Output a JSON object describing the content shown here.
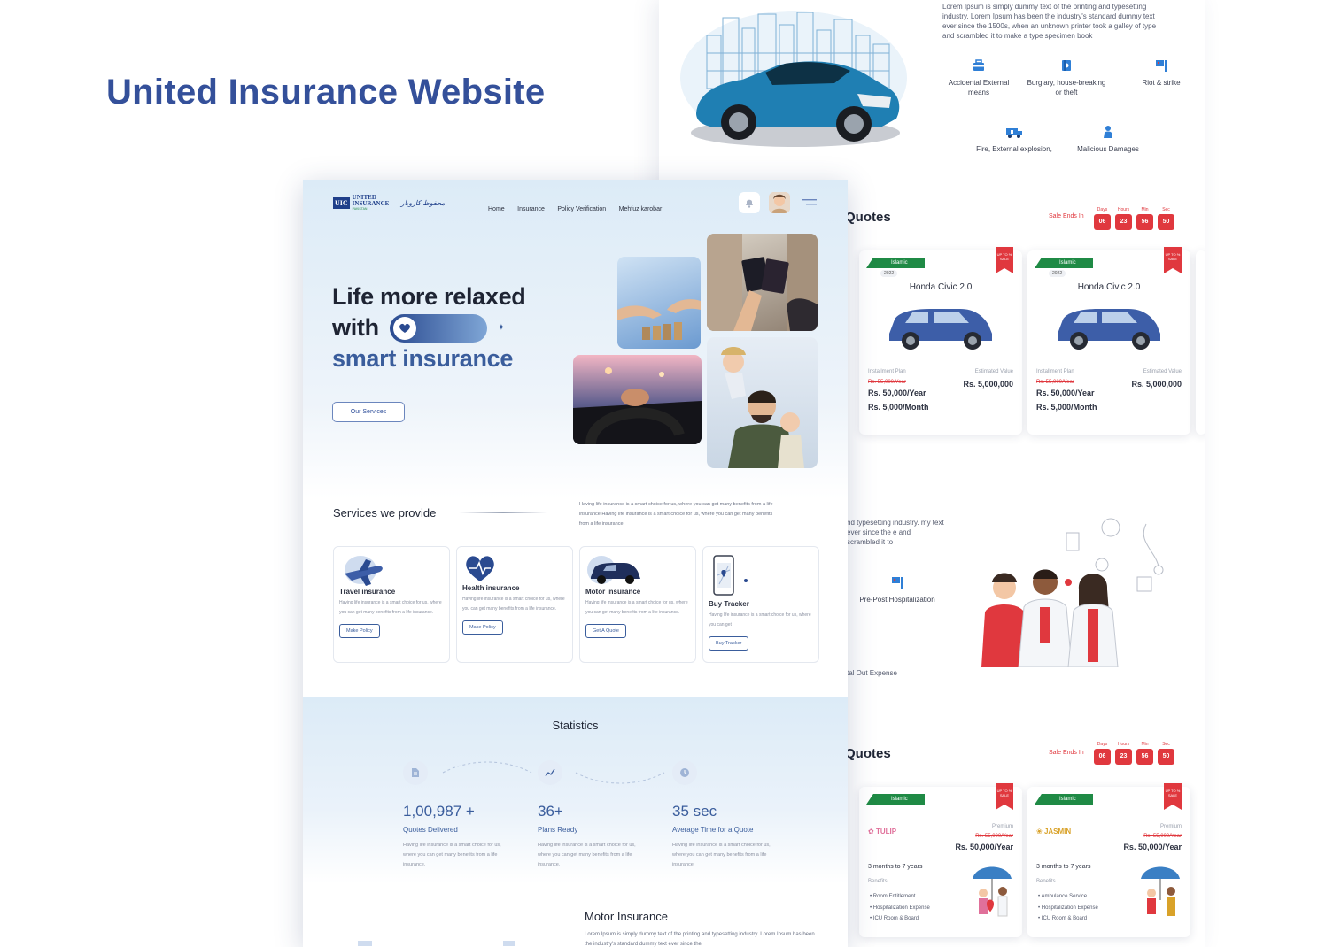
{
  "headline": "United Insurance Website",
  "back_page": {
    "intro_text": "Lorem Ipsum is simply dummy text of the printing and typesetting industry. Lorem Ipsum has been the industry's standard dummy text ever since the 1500s, when an unknown printer took a galley of type and scrambled it to make a type specimen book",
    "coverage_icons": [
      {
        "label": "Accidental External means",
        "icon": "toolbox-icon"
      },
      {
        "label": "Burglary, house-breaking or theft",
        "icon": "safe-icon"
      },
      {
        "label": "Riot & strike",
        "icon": "flag-icon"
      },
      {
        "label": "Fire, External explosion,",
        "icon": "fire-truck-icon"
      },
      {
        "label": "Malicious Damages",
        "icon": "person-icon"
      }
    ],
    "quotes_title": "Quotes",
    "sale_label": "Sale Ends In",
    "countdown": [
      {
        "unit": "Days",
        "value": "06"
      },
      {
        "unit": "Hours",
        "value": "23"
      },
      {
        "unit": "Min",
        "value": "56"
      },
      {
        "unit": "Sec",
        "value": "50"
      }
    ],
    "car_cards": [
      {
        "tag": "Islamic",
        "year": "2022",
        "ribbon": "UP TO % SALE",
        "name": "Honda Civic 2.0",
        "installment_label": "Installment Plan",
        "estimated_label": "Estimated Value",
        "old_price": "Rs. 55,000/Year",
        "price_year": "Rs. 50,000/Year",
        "price_month": "Rs. 5,000/Month",
        "estimated_value": "Rs. 5,000,000"
      },
      {
        "tag": "Islamic",
        "year": "2022",
        "ribbon": "UP TO % SALE",
        "name": "Honda Civic 2.0",
        "installment_label": "Installment Plan",
        "estimated_label": "Estimated Value",
        "old_price": "Rs. 55,000/Year",
        "price_year": "Rs. 50,000/Year",
        "price_month": "Rs. 5,000/Month",
        "estimated_value": "Rs. 5,000,000"
      }
    ],
    "health_text": "nd typesetting industry. my text ever since the e and scrambled it to",
    "prepost_label": "Pre-Post Hospitalization",
    "outpatient_label": "tal Out Expense",
    "quotes2_title": "Quotes",
    "health_cards": [
      {
        "tag": "Islamic",
        "brand": "TULIP",
        "premium_label": "Premium",
        "old_price": "Rs. 55,000/Year",
        "price": "Rs. 50,000/Year",
        "term": "3 months to 7 years",
        "benefits_label": "Benefits",
        "benefits": [
          "Room Entitlement",
          "Hospitalization Expense",
          "ICU Room & Board"
        ]
      },
      {
        "tag": "Islamic",
        "brand": "JASMIN",
        "premium_label": "Premium",
        "old_price": "Rs. 55,000/Year",
        "price": "Rs. 50,000/Year",
        "term": "3 months to 7 years",
        "benefits_label": "Benefits",
        "benefits": [
          "Ambulance Service",
          "Hospitalization Expense",
          "ICU Room & Board"
        ]
      }
    ]
  },
  "front_page": {
    "logo": {
      "mark": "UIC",
      "name": "UNITED INSURANCE",
      "sub": "PAKISTAN"
    },
    "nav": [
      "Home",
      "Insurance",
      "Policy Verification",
      "Mehfuz karobar"
    ],
    "hero": {
      "line1": "Life more relaxed",
      "line2": "with",
      "line3": "smart insurance",
      "button": "Our Services"
    },
    "services_title": "Services we provide",
    "services_desc": "Having life insurance is a smart choice for us, where you can get many benefits from a life insurance.Having life insurance is a smart choice for us, where you can get many benefits from a life insurance.",
    "services": [
      {
        "title": "Travel insurance",
        "desc": "Having life insurance is a smart choice for us, where you can get many benefits from a life insurance.",
        "button": "Make Policy",
        "icon": "airplane-icon"
      },
      {
        "title": "Health insurance",
        "desc": "Having life insurance is a smart choice for us, where you can get many benefits from a life insurance.",
        "button": "Make Policy",
        "icon": "heart-icon"
      },
      {
        "title": "Motor insurance",
        "desc": "Having life insurance is a smart choice for us, where you can get many benefits from a life insurance.",
        "button": "Get A Quote",
        "icon": "car-icon"
      },
      {
        "title": "Buy Tracker",
        "desc": "Having life insurance is a smart choice for us, where you can get",
        "button": "Buy Tracker",
        "icon": "phone-map-icon"
      }
    ],
    "statistics_title": "Statistics",
    "stats": [
      {
        "value": "1,00,987 +",
        "label": "Quotes Delivered",
        "desc": "Having life insurance is a smart choice for us, where you can get many benefits from a life insurance."
      },
      {
        "value": "36+",
        "label": "Plans Ready",
        "desc": "Having life insurance is a smart choice for us, where you can get many benefits from a life insurance."
      },
      {
        "value": "35 sec",
        "label": "Average Time for a Quote",
        "desc": "Having life insurance is a smart choice for us, where you can get many benefits from a life insurance."
      }
    ],
    "motor_title": "Motor Insurance",
    "motor_text": "Lorem Ipsum is simply dummy text of the printing and typesetting industry. Lorem Ipsum has been the industry's standard dummy text ever since the"
  },
  "colors": {
    "brand_blue": "#34509a",
    "accent_red": "#e0383e",
    "islamic_green": "#1f8a45",
    "car_blue": "#3d5ea8"
  }
}
